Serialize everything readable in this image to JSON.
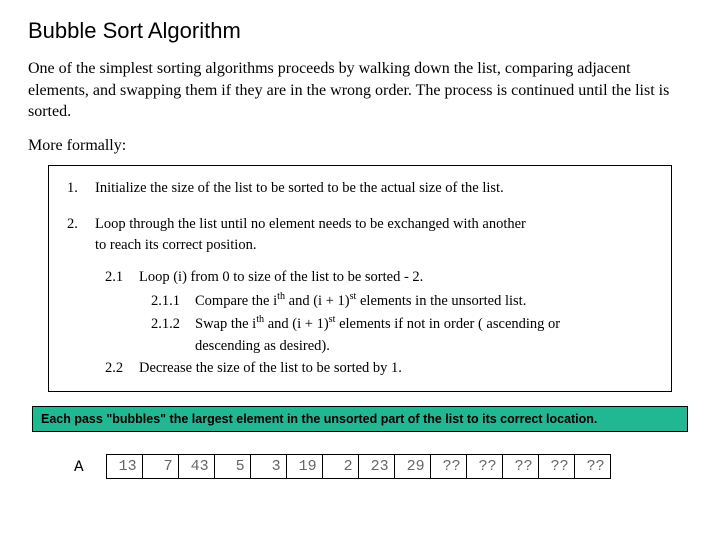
{
  "title": "Bubble Sort Algorithm",
  "intro": "One of the simplest sorting algorithms proceeds by walking down the list, comparing adjacent elements, and swapping them if they are in the wrong order.  The process is continued until the list is sorted.",
  "formal_label": "More formally:",
  "steps": {
    "s1_num": "1.",
    "s1_text": "Initialize the size of the list to be sorted to be the actual size of the list.",
    "s2_num": "2.",
    "s2_text_a": "Loop through the list until no element needs to be exchanged with another",
    "s2_text_b": "to reach its correct position.",
    "s21_num": "2.1",
    "s21_text": "Loop (i) from 0 to size of the list to be sorted - 2.",
    "s211_num": "2.1.1",
    "s211_pre": "Compare the i",
    "s211_sup1": "th",
    "s211_mid": " and (i + 1)",
    "s211_sup2": "st",
    "s211_post": " elements in the unsorted list.",
    "s212_num": "2.1.2",
    "s212_pre": "Swap the i",
    "s212_sup1": "th",
    "s212_mid": " and (i + 1)",
    "s212_sup2": "st",
    "s212_post": " elements if not in order ( ascending or",
    "s212_cont": "descending as desired).",
    "s22_num": "2.2",
    "s22_text": "Decrease the size of the list to be sorted by 1."
  },
  "highlight": "Each pass \"bubbles\" the largest element in the unsorted part of the list to its correct location.",
  "array": {
    "label": "A",
    "cells": [
      "13",
      "7",
      "43",
      "5",
      "3",
      "19",
      "2",
      "23",
      "29",
      "??",
      "??",
      "??",
      "??",
      "??"
    ]
  }
}
